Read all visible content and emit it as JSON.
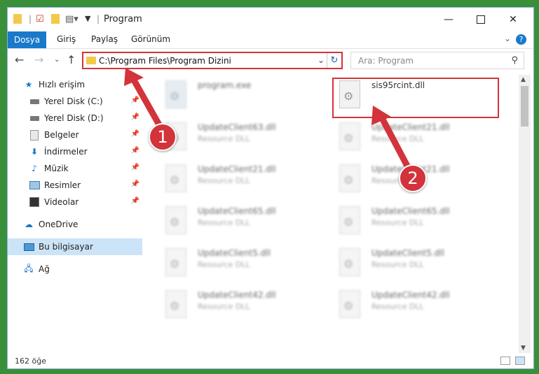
{
  "window": {
    "title": "Program"
  },
  "ribbon": {
    "tabs": [
      "Dosya",
      "Giriş",
      "Paylaş",
      "Görünüm"
    ]
  },
  "address": {
    "path": "C:\\Program Files\\Program Dizini"
  },
  "search": {
    "placeholder": "Ara: Program"
  },
  "sidebar": {
    "items": [
      {
        "label": "Hızlı erişim",
        "icon": "star-icon"
      },
      {
        "label": "Yerel Disk (C:)",
        "icon": "drive-icon"
      },
      {
        "label": "Yerel Disk (D:)",
        "icon": "drive-icon"
      },
      {
        "label": "Belgeler",
        "icon": "documents-icon"
      },
      {
        "label": "İndirmeler",
        "icon": "download-icon"
      },
      {
        "label": "Müzik",
        "icon": "music-icon"
      },
      {
        "label": "Resimler",
        "icon": "pictures-icon"
      },
      {
        "label": "Videolar",
        "icon": "video-icon"
      },
      {
        "label": "OneDrive",
        "icon": "cloud-icon"
      },
      {
        "label": "Bu bilgisayar",
        "icon": "computer-icon"
      },
      {
        "label": "Ağ",
        "icon": "network-icon"
      }
    ]
  },
  "files": [
    {
      "name": "program.exe",
      "type": ""
    },
    {
      "name": "sis95rcint.dll",
      "type": ""
    },
    {
      "name": "UpdateClient63.dll",
      "type": "Resource DLL"
    },
    {
      "name": "UpdateClient21.dll",
      "type": "Resource DLL"
    },
    {
      "name": "UpdateClient21.dll",
      "type": "Resource DLL"
    },
    {
      "name": "UpdateClient21.dll",
      "type": "Resource DLL"
    },
    {
      "name": "UpdateClient65.dll",
      "type": "Resource DLL"
    },
    {
      "name": "UpdateClient65.dll",
      "type": "Resource DLL"
    },
    {
      "name": "UpdateClient5.dll",
      "type": "Resource DLL"
    },
    {
      "name": "UpdateClient5.dll",
      "type": "Resource DLL"
    },
    {
      "name": "UpdateClient42.dll",
      "type": "Resource DLL"
    },
    {
      "name": "UpdateClient42.dll",
      "type": "Resource DLL"
    }
  ],
  "status": {
    "count": "162 öğe"
  },
  "annotations": {
    "step1": "1",
    "step2": "2"
  },
  "colors": {
    "accent": "#1979ca",
    "annotation": "#d3333a",
    "selected": "#cce4f7"
  }
}
